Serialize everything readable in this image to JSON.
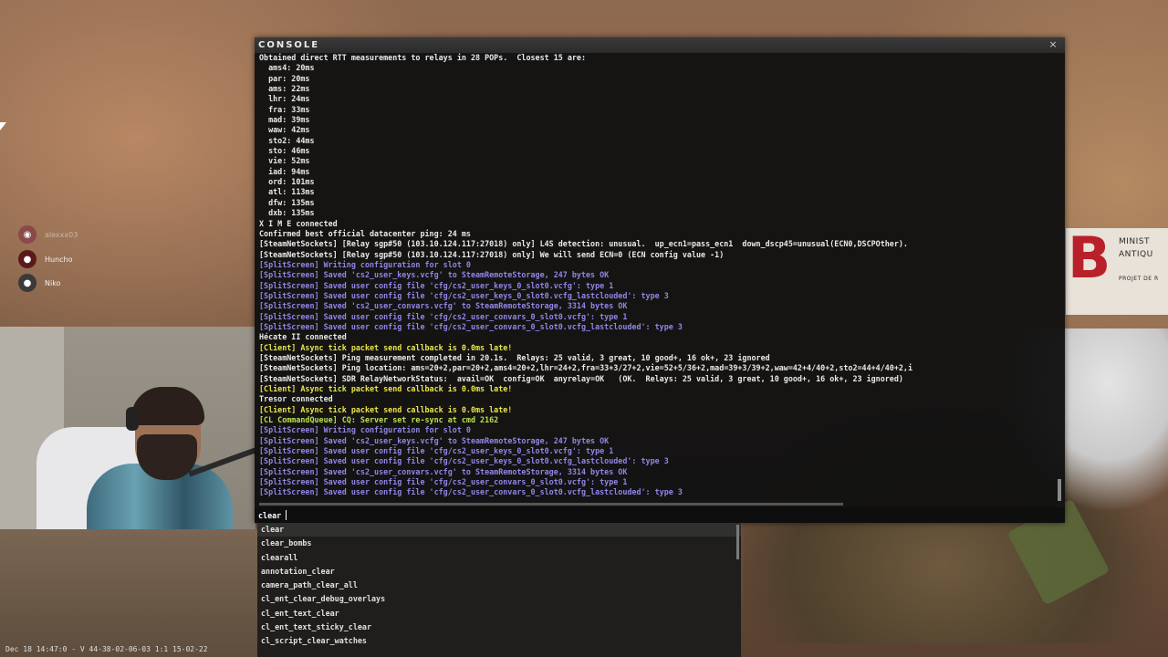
{
  "console": {
    "title": "CONSOLE",
    "close_glyph": "×",
    "log": [
      {
        "text": "Obtained direct RTT measurements to relays in 28 POPs.  Closest 15 are:",
        "color": "white"
      },
      {
        "text": "  ams4: 20ms",
        "color": "white"
      },
      {
        "text": "  par: 20ms",
        "color": "white"
      },
      {
        "text": "  ams: 22ms",
        "color": "white"
      },
      {
        "text": "  lhr: 24ms",
        "color": "white"
      },
      {
        "text": "  fra: 33ms",
        "color": "white"
      },
      {
        "text": "  mad: 39ms",
        "color": "white"
      },
      {
        "text": "  waw: 42ms",
        "color": "white"
      },
      {
        "text": "  sto2: 44ms",
        "color": "white"
      },
      {
        "text": "  sto: 46ms",
        "color": "white"
      },
      {
        "text": "  vie: 52ms",
        "color": "white"
      },
      {
        "text": "  iad: 94ms",
        "color": "white"
      },
      {
        "text": "  ord: 101ms",
        "color": "white"
      },
      {
        "text": "  atl: 113ms",
        "color": "white"
      },
      {
        "text": "  dfw: 135ms",
        "color": "white"
      },
      {
        "text": "  dxb: 135ms",
        "color": "white"
      },
      {
        "text": "X I M E connected",
        "color": "white"
      },
      {
        "text": "Confirmed best official datacenter ping: 24 ms",
        "color": "white"
      },
      {
        "text": "[SteamNetSockets] [Relay sgp#50 (103.10.124.117:27018) only] L4S detection: unusual.  up_ecn1=pass_ecn1  down_dscp45=unusual(ECN0,DSCPOther).",
        "color": "white"
      },
      {
        "text": "[SteamNetSockets] [Relay sgp#50 (103.10.124.117:27018) only] We will send ECN=0 (ECN config value -1)",
        "color": "white"
      },
      {
        "text": "[SplitScreen] Writing configuration for slot 0",
        "color": "purple"
      },
      {
        "text": "[SplitScreen] Saved 'cs2_user_keys.vcfg' to SteamRemoteStorage, 247 bytes OK",
        "color": "purple"
      },
      {
        "text": "[SplitScreen] Saved user config file 'cfg/cs2_user_keys_0_slot0.vcfg': type 1",
        "color": "purple"
      },
      {
        "text": "[SplitScreen] Saved user config file 'cfg/cs2_user_keys_0_slot0.vcfg_lastclouded': type 3",
        "color": "purple"
      },
      {
        "text": "[SplitScreen] Saved 'cs2_user_convars.vcfg' to SteamRemoteStorage, 3314 bytes OK",
        "color": "purple"
      },
      {
        "text": "[SplitScreen] Saved user config file 'cfg/cs2_user_convars_0_slot0.vcfg': type 1",
        "color": "purple"
      },
      {
        "text": "[SplitScreen] Saved user config file 'cfg/cs2_user_convars_0_slot0.vcfg_lastclouded': type 3",
        "color": "purple"
      },
      {
        "text": "Hécate II connected",
        "color": "white"
      },
      {
        "text": "[Client] Async tick packet send callback is 0.0ms late!",
        "color": "yellow"
      },
      {
        "text": "[SteamNetSockets] Ping measurement completed in 20.1s.  Relays: 25 valid, 3 great, 10 good+, 16 ok+, 23 ignored",
        "color": "white"
      },
      {
        "text": "[SteamNetSockets] Ping location: ams=20+2,par=20+2,ams4=20+2,lhr=24+2,fra=33+3/27+2,vie=52+5/36+2,mad=39+3/39+2,waw=42+4/40+2,sto2=44+4/40+2,i",
        "color": "white"
      },
      {
        "text": "[SteamNetSockets] SDR RelayNetworkStatus:  avail=OK  config=OK  anyrelay=OK   (OK.  Relays: 25 valid, 3 great, 10 good+, 16 ok+, 23 ignored)",
        "color": "white"
      },
      {
        "text": "[Client] Async tick packet send callback is 0.0ms late!",
        "color": "yellow"
      },
      {
        "text": "Tresor connected",
        "color": "white"
      },
      {
        "text": "[Client] Async tick packet send callback is 0.0ms late!",
        "color": "yellow"
      },
      {
        "text": "[CL CommandQueue] CQ: Server set re-sync at cmd 2162",
        "color": "green"
      },
      {
        "text": "[SplitScreen] Writing configuration for slot 0",
        "color": "purple"
      },
      {
        "text": "[SplitScreen] Saved 'cs2_user_keys.vcfg' to SteamRemoteStorage, 247 bytes OK",
        "color": "purple"
      },
      {
        "text": "[SplitScreen] Saved user config file 'cfg/cs2_user_keys_0_slot0.vcfg': type 1",
        "color": "purple"
      },
      {
        "text": "[SplitScreen] Saved user config file 'cfg/cs2_user_keys_0_slot0.vcfg_lastclouded': type 3",
        "color": "purple"
      },
      {
        "text": "[SplitScreen] Saved 'cs2_user_convars.vcfg' to SteamRemoteStorage, 3314 bytes OK",
        "color": "purple"
      },
      {
        "text": "[SplitScreen] Saved user config file 'cfg/cs2_user_convars_0_slot0.vcfg': type 1",
        "color": "purple"
      },
      {
        "text": "[SplitScreen] Saved user config file 'cfg/cs2_user_convars_0_slot0.vcfg_lastclouded': type 3",
        "color": "purple"
      }
    ],
    "input_value": "clear"
  },
  "autocomplete": [
    "clear",
    "clear_bombs",
    "clearall",
    "annotation_clear",
    "camera_path_clear_all",
    "cl_ent_clear_debug_overlays",
    "cl_ent_text_clear",
    "cl_ent_text_sticky_clear",
    "cl_script_clear_watches"
  ],
  "voice_users": [
    {
      "name": "alexxx03",
      "muted": true,
      "avatar_icon": "discord-icon",
      "avatar_color": "#8a4a4a",
      "glyph": "◉"
    },
    {
      "name": "Huncho",
      "muted": false,
      "avatar_icon": "avatar-huncho",
      "avatar_color": "#5a1a1a",
      "glyph": "●"
    },
    {
      "name": "Niko",
      "muted": false,
      "avatar_icon": "avatar-niko",
      "avatar_color": "#3a3a3a",
      "glyph": "●"
    }
  ],
  "scene": {
    "sign_letter": "B",
    "sign_line1": "MINIST",
    "sign_line2": "ANTIQU",
    "sign_line3": "PROJET DE R"
  },
  "status_bar": "Dec 18 14:47:0 - V 44-38-02-06-03 1:1 15-02-22",
  "colors": {
    "white": "#e9e9e9",
    "purple": "#8f86e6",
    "yellow": "#e8e54a",
    "green": "#b8e050"
  }
}
